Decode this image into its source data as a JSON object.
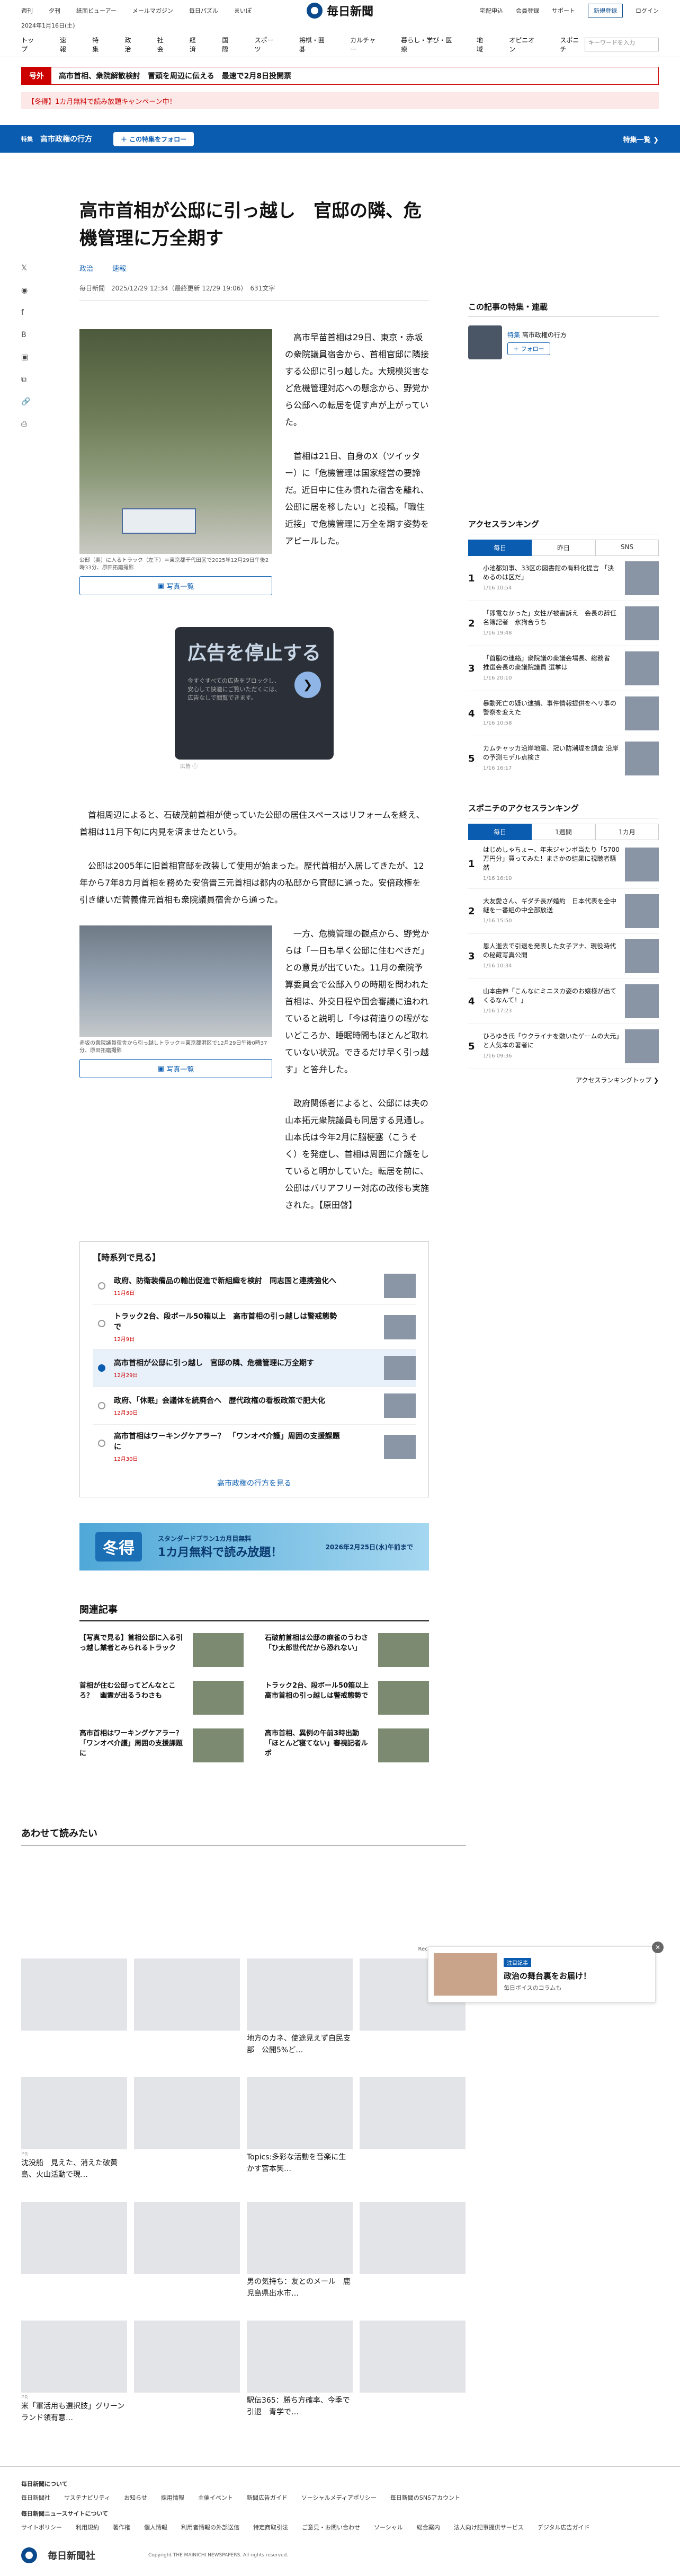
{
  "topbar": {
    "links": [
      "週刊",
      "夕刊",
      "紙面ビューアー",
      "メールマガジン",
      "毎日パズル",
      "まいぽ"
    ],
    "logo": "毎日新聞",
    "right": [
      "宅配申込",
      "会員登録",
      "サポート"
    ],
    "signup": "新規登録",
    "login": "ログイン"
  },
  "date": "2024年1月16日(土)",
  "nav": {
    "items": [
      "トップ",
      "速報",
      "特集",
      "政治",
      "社会",
      "経済",
      "国際",
      "スポーツ",
      "将棋・囲碁",
      "カルチャー",
      "暮らし・学び・医療",
      "地域",
      "オピニオン",
      "スポニチ"
    ],
    "search_placeholder": "キーワードを入力"
  },
  "breaking": {
    "tag": "号外",
    "text": "高市首相、衆院解散検討　冒頭を周辺に伝える　最速で2月8日投開票"
  },
  "promo": "【冬得】1カ月無料で読み放題キャンペーン中！",
  "feature": {
    "label": "特集",
    "title": "高市政権の行方",
    "follow": "＋ この特集をフォロー",
    "list": "特集一覧 ❯"
  },
  "share": [
    "𝕏",
    "◉",
    "f",
    "B",
    "▣",
    "⧉",
    "🔗",
    "⎙"
  ],
  "article": {
    "title": "高市首相が公邸に引っ越し　官邸の隣、危機管理に万全期す",
    "tags": [
      "政治",
      "速報"
    ],
    "meta": "毎日新聞　2025/12/29 12:34（最終更新 12/29 19:06）　631文字",
    "p1": "高市早苗首相は29日、東京・赤坂の衆院議員宿舎から、首相官邸に隣接する公邸に引っ越した。大規模災害など危機管理対応への懸念から、野党から公邸への転居を促す声が上がっていた。",
    "p2": "首相は21日、自身のX（ツイッター）に「危機管理は国家経営の要諦だ。近日中に住み慣れた宿舎を離れ、公邸に居を移したい」と投稿。「職住近接」で危機管理に万全を期す姿勢をアピールした。",
    "cap1": "公邸（奥）に入るトラック（左下）＝東京都千代田区で2025年12月29日午後2時33分、原田拓磨撮影",
    "photo_btn": "写真一覧",
    "p3": "首相周辺によると、石破茂前首相が使っていた公邸の居住スペースはリフォームを終え、首相は11月下旬に内見を済ませたという。",
    "p4": "公邸は2005年に旧首相官邸を改装して使用が始まった。歴代首相が入居してきたが、12年から7年8カ月首相を務めた安倍晋三元首相は都内の私邸から官邸に通った。安倍政権を引き継いだ菅義偉元首相も衆院議員宿舎から通った。",
    "p5": "一方、危機管理の観点から、野党からは「一日も早く公邸に住むべきだ」との意見が出ていた。11月の衆院予算委員会で公邸入りの時期を問われた首相は、外交日程や国会審議に追われていると説明し「今は荷造りの暇がないどころか、睡眠時間もほとんど取れていない状況。できるだけ早く引っ越す」と答弁した。",
    "p6": "政府関係者によると、公邸には夫の山本拓元衆院議員も同居する見通し。山本氏は今年2月に脳梗塞（こうそく）を発症し、首相は周囲に介護をしていると明かしていた。転居を前に、公邸はバリアフリー対応の改修も実施された。【原田啓】",
    "cap2": "赤坂の衆院議員宿舎から引っ越しトラック＝東京都港区で12月29日午後0時37分、原田拓磨撮影"
  },
  "ad": {
    "headline": "広告を停止する",
    "sub": "今すぐすべての広告をブロックし、安心して快適にご覧いただくには、広告なしで閲覧できます。",
    "label": "広告 ⓘ"
  },
  "timeline": {
    "title": "【時系列で見る】",
    "items": [
      {
        "text": "政府、防衛装備品の輸出促進で新組織を検討　同志国と連携強化へ",
        "date": "11月6日"
      },
      {
        "text": "トラック2台、段ボール50箱以上　高市首相の引っ越しは警戒態勢で",
        "date": "12月9日"
      },
      {
        "text": "高市首相が公邸に引っ越し　官邸の隣、危機管理に万全期す",
        "date": "12月29日"
      },
      {
        "text": "政府、「休眠」会議体を統廃合へ　歴代政権の看板政策で肥大化",
        "date": "12月30日"
      },
      {
        "text": "高市首相はワーキングケアラー？　「ワンオペ介護」周囲の支援課題に",
        "date": "12月30日"
      }
    ],
    "more": "高市政権の行方を見る"
  },
  "banner": {
    "winter": "冬得",
    "text": "スタンダードプラン1カ月目無料",
    "big": "1カ月無料で読み放題！",
    "deadline": "2026年2月25日(水)午前まで"
  },
  "related": {
    "title": "関連記事",
    "items": [
      "【写真で見る】首相公邸に入る引っ越し業者とみられるトラック",
      "石破前首相は公邸の麻雀のうわさ「ひ太郎世代だから恐れない」",
      "首相が住む公邸ってどんなところ？　幽霊が出るうわさも",
      "トラック2台、段ボール50箱以上　高市首相の引っ越しは警戒態勢で",
      "高市首相はワーキングケアラー？　「ワンオペ介護」周囲の支援課題に",
      "高市首相、異例の午前3時出勤「ほとんど寝てない」審視記者ルポ"
    ]
  },
  "sidebar": {
    "series_title": "この記事の特集・連載",
    "series_label": "特集",
    "series_name": "高市政権の行方",
    "follow": "＋ フォロー",
    "ranking_title": "アクセスランキング",
    "tabs": [
      "毎日",
      "昨日",
      "SNS"
    ],
    "ranking": [
      {
        "text": "小池都知事、33区の図書館の有料化提言 「決めるのは区だ」",
        "time": "1/16 10:54"
      },
      {
        "text": "「即電なかった」女性が被害訴え　会長の辞任 名簿記者　氷狗合うち",
        "time": "1/16 19:48"
      },
      {
        "text": "「首脳の連絡」衆院議の衆議会場長、総務省　推選会長の衆議院議員 選挙は",
        "time": "1/16 20:10"
      },
      {
        "text": "暴動死亡の疑い逮捕、事件情報提供をヘリ事の警察を変えた",
        "time": "1/16 10:58"
      },
      {
        "text": "カムチャッカ沿岸地震、冠い防潮堤を調査 沿岸の予測モデル点検さ",
        "time": "1/16 16:17"
      }
    ],
    "sponichi_title": "スポニチのアクセスランキング",
    "sponichi_tabs": [
      "毎日",
      "1週間",
      "1カ月"
    ],
    "sponichi": [
      {
        "text": "はじめしゃちょー、年末ジャンボ当たり「5700万円分」買ってみた！まさかの結果に視聴者騒然",
        "time": "1/16 16:10"
      },
      {
        "text": "大友愛さん、ギダチ長が婚約　日本代表を全中継をー番組の中全部放送",
        "time": "1/16 15:50"
      },
      {
        "text": "恩人逝去で引退を発表した女子アナ、現役時代の秘蔵写真公開",
        "time": "1/16 10:34"
      },
      {
        "text": "山本由伸「こんなにミニスカ姿のお嬢様が出てくるなんて！」",
        "time": "1/16 17:23"
      },
      {
        "text": "ひろゆき氏「ウクライナを敷いたゲームの大元」と人気本の著者に",
        "time": "1/16 09:36"
      }
    ],
    "ranking_more": "アクセスランキングトップ ❯"
  },
  "recommend": {
    "title": "あわせて読みたい",
    "credit": "Recommended by",
    "items": [
      {
        "label": "",
        "title": ""
      },
      {
        "label": "",
        "title": ""
      },
      {
        "label": "",
        "title": "地方のカネ、使途見えず自民支部　公開5%ど…"
      },
      {
        "label": "",
        "title": ""
      },
      {
        "label": "PR",
        "title": "沈没船　見えた、消えた破黄島、火山活動で現…"
      },
      {
        "label": "",
        "title": ""
      },
      {
        "label": "",
        "title": "Topics:多彩な活動を音楽に生かす宮本笑…"
      },
      {
        "label": "",
        "title": ""
      },
      {
        "label": "",
        "title": ""
      },
      {
        "label": "",
        "title": ""
      },
      {
        "label": "",
        "title": "男の気持ち：友とのメール　鹿児島県出水市…"
      },
      {
        "label": "",
        "title": ""
      },
      {
        "label": "PR",
        "title": "米「軍活用も選択肢」グリーンランド領有意…"
      },
      {
        "label": "",
        "title": ""
      },
      {
        "label": "",
        "title": "駅伝365：勝ち方確率、今季で引退　青学で…"
      },
      {
        "label": "",
        "title": ""
      }
    ]
  },
  "floating": {
    "badge": "注目記事",
    "title": "政治の舞台裏をお届け！",
    "sub": "毎日ボイスのコラムも"
  },
  "footer": {
    "about": "毎日新聞について",
    "links1": [
      "毎日新聞社",
      "サステナビリティ",
      "お知らせ",
      "採用情報",
      "主催イベント",
      "新聞広告ガイド",
      "ソーシャルメディアポリシー",
      "毎日新聞のSNSアカウント"
    ],
    "others": "毎日新聞ニュースサイトについて",
    "links2": [
      "サイトポリシー",
      "利用規約",
      "著作権",
      "個人情報",
      "利用者情報の外部送信",
      "特定商取引法",
      "ご意見・お問い合わせ",
      "ソーシャル",
      "総合案内",
      "法人向け記事提供サービス",
      "デジタル広告ガイド"
    ],
    "company": "毎日新聞社",
    "copy": "Copyright THE MAINICHI NEWSPAPERS. All rights reserved."
  }
}
